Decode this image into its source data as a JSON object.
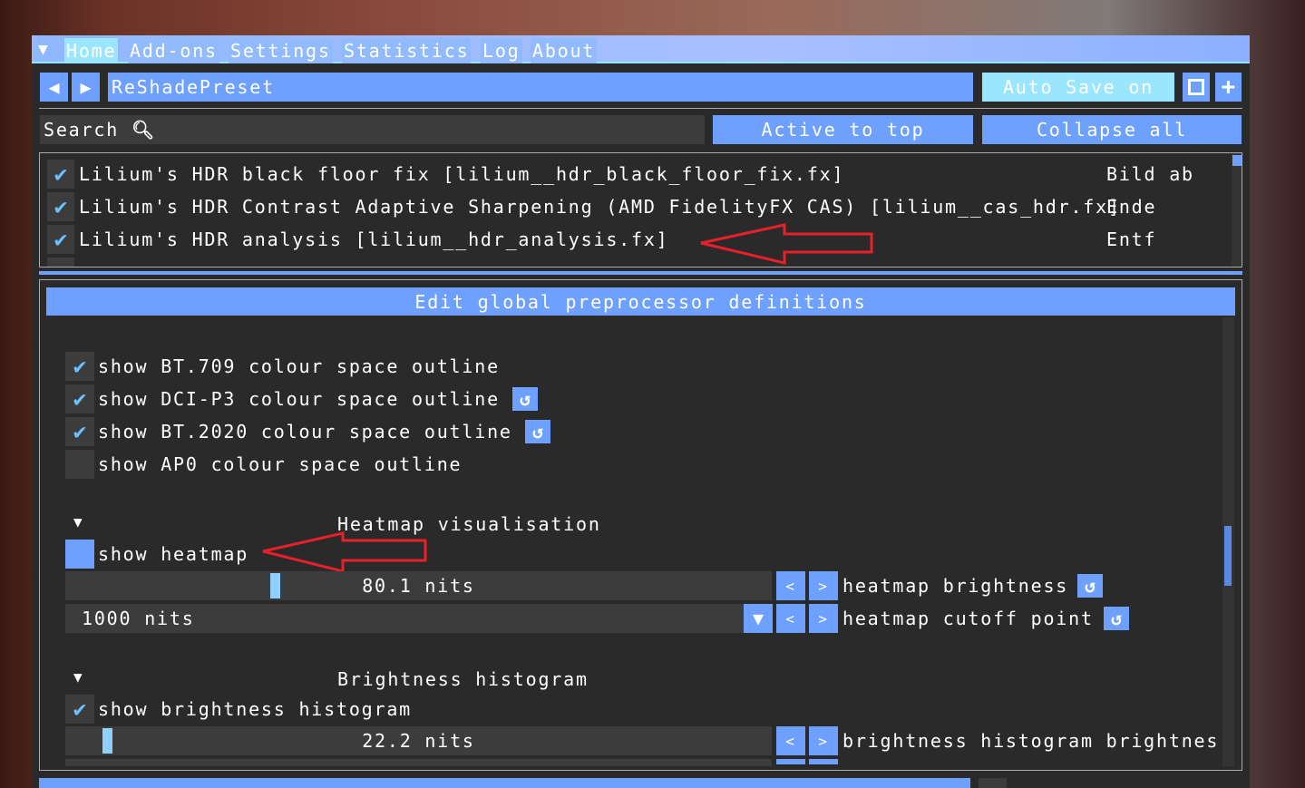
{
  "tabs": [
    {
      "label": "Home",
      "selected": true
    },
    {
      "label": "Add-ons"
    },
    {
      "label": "Settings"
    },
    {
      "label": "Statistics"
    },
    {
      "label": "Log"
    },
    {
      "label": "About"
    }
  ],
  "toolbar": {
    "preset": "ReShadePreset",
    "auto_save": "Auto Save on",
    "search_label": "Search",
    "active_to_top": "Active to top",
    "collapse_all": "Collapse all"
  },
  "effects": [
    {
      "name": "Lilium's HDR black floor fix [lilium__hdr_black_floor_fix.fx]",
      "key": "Bild ab",
      "checked": true
    },
    {
      "name": "Lilium's HDR Contrast Adaptive Sharpening (AMD FidelityFX CAS) [lilium__cas_hdr.fx]",
      "key": "Ende",
      "checked": true
    },
    {
      "name": "Lilium's HDR analysis [lilium__hdr_analysis.fx]",
      "key": "Entf",
      "checked": true
    }
  ],
  "settings": {
    "header": "Edit global preprocessor definitions",
    "outlines": [
      {
        "label": "show BT.709 colour space outline",
        "checked": true,
        "reset": false
      },
      {
        "label": "show DCI-P3 colour space outline",
        "checked": true,
        "reset": true
      },
      {
        "label": "show BT.2020 colour space outline",
        "checked": true,
        "reset": true
      },
      {
        "label": "show AP0 colour space outline",
        "checked": false,
        "reset": false
      }
    ],
    "heatmap": {
      "title": "Heatmap visualisation",
      "show_label": "show heatmap",
      "brightness_value": "80.1 nits",
      "brightness_label": "heatmap brightness",
      "cutoff_value": "1000 nits",
      "cutoff_label": "heatmap cutoff point"
    },
    "histogram": {
      "title": "Brightness histogram",
      "show_label": "show brightness histogram",
      "brightness_value": "22.2 nits",
      "brightness_label": "brightness histogram brightnes"
    },
    "step_left": "<",
    "step_right": ">"
  },
  "colors": {
    "accent": "#6ea0ff",
    "active": "#9ae6ff",
    "annotation": "#e8202a"
  }
}
